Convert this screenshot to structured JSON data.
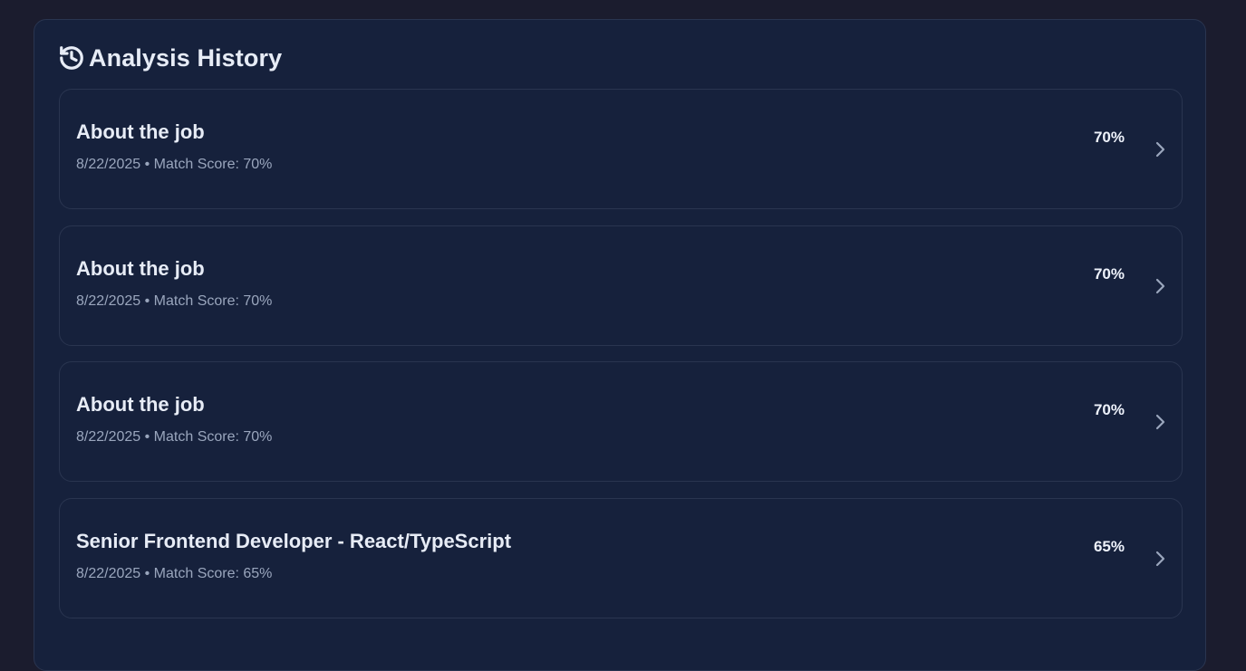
{
  "header": {
    "title": "Analysis History",
    "icon": "history-icon"
  },
  "colors": {
    "page_background": "#1b1c2e",
    "panel_background": "#16213c",
    "border": "#2a3550",
    "title_text": "#e7ecf6",
    "meta_text": "#9aa6bd"
  },
  "history": {
    "items": [
      {
        "title": "About the job",
        "date": "8/22/2025",
        "meta": "8/22/2025 • Match Score: 70%",
        "score": "70%"
      },
      {
        "title": "About the job",
        "date": "8/22/2025",
        "meta": "8/22/2025 • Match Score: 70%",
        "score": "70%"
      },
      {
        "title": "About the job",
        "date": "8/22/2025",
        "meta": "8/22/2025 • Match Score: 70%",
        "score": "70%"
      },
      {
        "title": "Senior Frontend Developer - React/TypeScript",
        "date": "8/22/2025",
        "meta": "8/22/2025 • Match Score: 65%",
        "score": "65%"
      }
    ]
  }
}
